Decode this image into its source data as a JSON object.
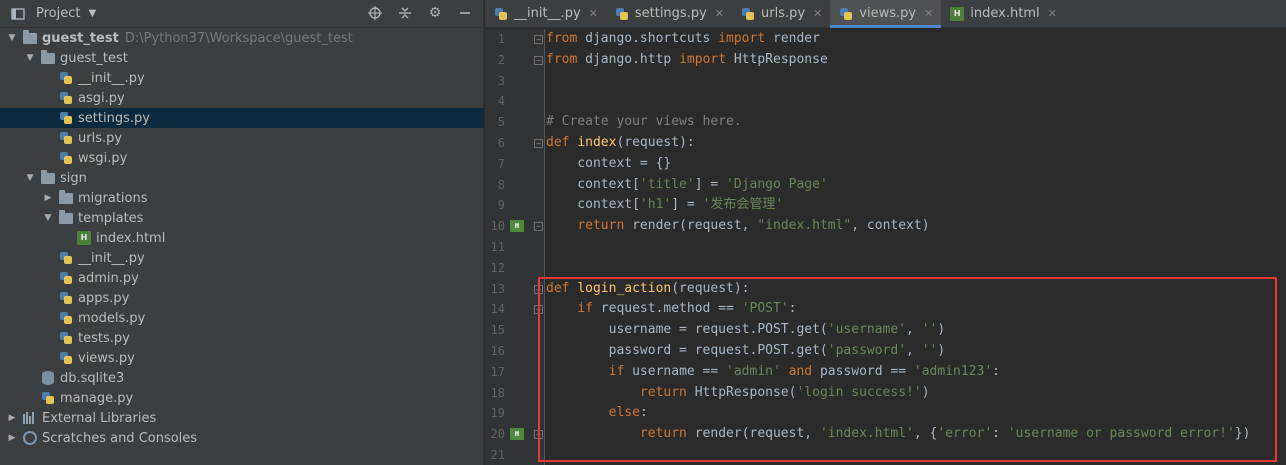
{
  "project_panel": {
    "title": "Project",
    "tree": [
      {
        "id": "root",
        "label": "guest_test",
        "path": "D:\\Python37\\Workspace\\guest_test",
        "depth": 0,
        "arrow": "down",
        "icon": "folder-icon",
        "bold": true
      },
      {
        "id": "guest_test_pkg",
        "label": "guest_test",
        "depth": 1,
        "arrow": "down",
        "icon": "folder-icon"
      },
      {
        "id": "gt_init",
        "label": "__init__.py",
        "depth": 2,
        "arrow": "none",
        "icon": "python-file-icon"
      },
      {
        "id": "asgi",
        "label": "asgi.py",
        "depth": 2,
        "arrow": "none",
        "icon": "python-file-icon"
      },
      {
        "id": "settings",
        "label": "settings.py",
        "depth": 2,
        "arrow": "none",
        "icon": "python-file-icon",
        "selected": true
      },
      {
        "id": "urls",
        "label": "urls.py",
        "depth": 2,
        "arrow": "none",
        "icon": "python-file-icon"
      },
      {
        "id": "wsgi",
        "label": "wsgi.py",
        "depth": 2,
        "arrow": "none",
        "icon": "python-file-icon"
      },
      {
        "id": "sign",
        "label": "sign",
        "depth": 1,
        "arrow": "down",
        "icon": "folder-icon"
      },
      {
        "id": "migrations",
        "label": "migrations",
        "depth": 2,
        "arrow": "right",
        "icon": "folder-icon"
      },
      {
        "id": "templates",
        "label": "templates",
        "depth": 2,
        "arrow": "down",
        "icon": "folder-icon"
      },
      {
        "id": "index_html",
        "label": "index.html",
        "depth": 3,
        "arrow": "none",
        "icon": "html-file-icon"
      },
      {
        "id": "sign_init",
        "label": "__init__.py",
        "depth": 2,
        "arrow": "none",
        "icon": "python-file-icon"
      },
      {
        "id": "admin",
        "label": "admin.py",
        "depth": 2,
        "arrow": "none",
        "icon": "python-file-icon"
      },
      {
        "id": "apps",
        "label": "apps.py",
        "depth": 2,
        "arrow": "none",
        "icon": "python-file-icon"
      },
      {
        "id": "models",
        "label": "models.py",
        "depth": 2,
        "arrow": "none",
        "icon": "python-file-icon"
      },
      {
        "id": "tests",
        "label": "tests.py",
        "depth": 2,
        "arrow": "none",
        "icon": "python-file-icon"
      },
      {
        "id": "views",
        "label": "views.py",
        "depth": 2,
        "arrow": "none",
        "icon": "python-file-icon"
      },
      {
        "id": "db",
        "label": "db.sqlite3",
        "depth": 1,
        "arrow": "none",
        "icon": "database-icon"
      },
      {
        "id": "manage",
        "label": "manage.py",
        "depth": 1,
        "arrow": "none",
        "icon": "python-file-icon"
      },
      {
        "id": "ext_libs",
        "label": "External Libraries",
        "depth": 0,
        "arrow": "right",
        "icon": "library-icon"
      },
      {
        "id": "scratches",
        "label": "Scratches and Consoles",
        "depth": 0,
        "arrow": "right",
        "icon": "scratch-icon"
      }
    ]
  },
  "tabs": [
    {
      "label": "__init__.py",
      "icon": "python-file-icon",
      "active": false
    },
    {
      "label": "settings.py",
      "icon": "python-file-icon",
      "active": false
    },
    {
      "label": "urls.py",
      "icon": "python-file-icon",
      "active": false
    },
    {
      "label": "views.py",
      "icon": "python-file-icon",
      "active": true
    },
    {
      "label": "index.html",
      "icon": "html-file-icon",
      "active": false
    }
  ],
  "code": {
    "lines": [
      {
        "n": "1",
        "tokens": [
          [
            "kw",
            "from"
          ],
          [
            "plain",
            " django.shortcuts "
          ],
          [
            "kw",
            "import"
          ],
          [
            "plain",
            " render"
          ]
        ],
        "fold": true
      },
      {
        "n": "2",
        "tokens": [
          [
            "kw",
            "from"
          ],
          [
            "plain",
            " django.http "
          ],
          [
            "kw",
            "import"
          ],
          [
            "plain",
            " HttpResponse"
          ]
        ],
        "fold": true
      },
      {
        "n": "3",
        "tokens": []
      },
      {
        "n": "4",
        "tokens": []
      },
      {
        "n": "5",
        "tokens": [
          [
            "cmt",
            "# Create your views here."
          ]
        ]
      },
      {
        "n": "6",
        "tokens": [
          [
            "kw",
            "def"
          ],
          [
            "plain",
            " "
          ],
          [
            "fn",
            "index"
          ],
          [
            "plain",
            "(request):"
          ]
        ],
        "fold": true
      },
      {
        "n": "7",
        "tokens": [
          [
            "plain",
            "    context = {}"
          ]
        ]
      },
      {
        "n": "8",
        "tokens": [
          [
            "plain",
            "    context["
          ],
          [
            "str",
            "'title'"
          ],
          [
            "plain",
            "] = "
          ],
          [
            "str",
            "'Django Page'"
          ]
        ]
      },
      {
        "n": "9",
        "tokens": [
          [
            "plain",
            "    context["
          ],
          [
            "str",
            "'h1'"
          ],
          [
            "plain",
            "] = "
          ],
          [
            "str",
            "'发布会管理'"
          ]
        ]
      },
      {
        "n": "10",
        "tokens": [
          [
            "plain",
            "    "
          ],
          [
            "kw",
            "return"
          ],
          [
            "plain",
            " render(request, "
          ],
          [
            "str",
            "\"index.html\""
          ],
          [
            "plain",
            ", context)"
          ]
        ],
        "fold": true,
        "mark": true
      },
      {
        "n": "11",
        "tokens": []
      },
      {
        "n": "12",
        "tokens": []
      },
      {
        "n": "13",
        "tokens": [
          [
            "kw",
            "def"
          ],
          [
            "plain",
            " "
          ],
          [
            "fn",
            "login_action"
          ],
          [
            "plain",
            "(request):"
          ]
        ],
        "fold": true
      },
      {
        "n": "14",
        "tokens": [
          [
            "plain",
            "    "
          ],
          [
            "kw",
            "if"
          ],
          [
            "plain",
            " request.method == "
          ],
          [
            "str",
            "'POST'"
          ],
          [
            "plain",
            ":"
          ]
        ],
        "fold": true
      },
      {
        "n": "15",
        "tokens": [
          [
            "plain",
            "        username = request.POST.get("
          ],
          [
            "str",
            "'username'"
          ],
          [
            "plain",
            ", "
          ],
          [
            "str",
            "''"
          ],
          [
            "plain",
            ")"
          ]
        ]
      },
      {
        "n": "16",
        "tokens": [
          [
            "plain",
            "        password = request.POST.get("
          ],
          [
            "str",
            "'password'"
          ],
          [
            "plain",
            ", "
          ],
          [
            "str",
            "''"
          ],
          [
            "plain",
            ")"
          ]
        ]
      },
      {
        "n": "17",
        "tokens": [
          [
            "plain",
            "        "
          ],
          [
            "kw",
            "if"
          ],
          [
            "plain",
            " username == "
          ],
          [
            "str",
            "'admin'"
          ],
          [
            "plain",
            " "
          ],
          [
            "kw",
            "and"
          ],
          [
            "plain",
            " password == "
          ],
          [
            "str",
            "'admin123'"
          ],
          [
            "plain",
            ":"
          ]
        ]
      },
      {
        "n": "18",
        "tokens": [
          [
            "plain",
            "            "
          ],
          [
            "kw",
            "return"
          ],
          [
            "plain",
            " HttpResponse("
          ],
          [
            "str",
            "'login success!'"
          ],
          [
            "plain",
            ")"
          ]
        ]
      },
      {
        "n": "19",
        "tokens": [
          [
            "plain",
            "        "
          ],
          [
            "kw",
            "else"
          ],
          [
            "plain",
            ":"
          ]
        ]
      },
      {
        "n": "20",
        "tokens": [
          [
            "plain",
            "            "
          ],
          [
            "kw",
            "return"
          ],
          [
            "plain",
            " render(request, "
          ],
          [
            "str",
            "'index.html'"
          ],
          [
            "plain",
            ", {"
          ],
          [
            "str",
            "'error'"
          ],
          [
            "plain",
            ": "
          ],
          [
            "str",
            "'username or password error!'"
          ],
          [
            "plain",
            "})"
          ]
        ],
        "fold": true,
        "mark": true
      },
      {
        "n": "21",
        "tokens": []
      }
    ]
  },
  "colors": {
    "keyword": "#cc7832",
    "function": "#ffc66d",
    "string": "#6a8759",
    "comment": "#808080",
    "highlight_box": "#e53935",
    "selection": "#0d293e"
  }
}
